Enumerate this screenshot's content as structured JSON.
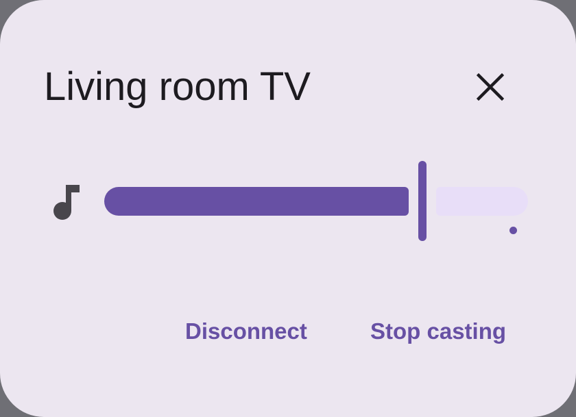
{
  "dialog": {
    "title": "Living room TV",
    "close_icon": "close-icon"
  },
  "volume": {
    "icon": "music-note-icon",
    "level_fraction": 0.75
  },
  "actions": {
    "disconnect_label": "Disconnect",
    "stop_casting_label": "Stop casting"
  },
  "colors": {
    "accent": "#6750a4",
    "surface": "#ece6f0",
    "track_inactive": "#e8def8",
    "text": "#1d1b20"
  }
}
